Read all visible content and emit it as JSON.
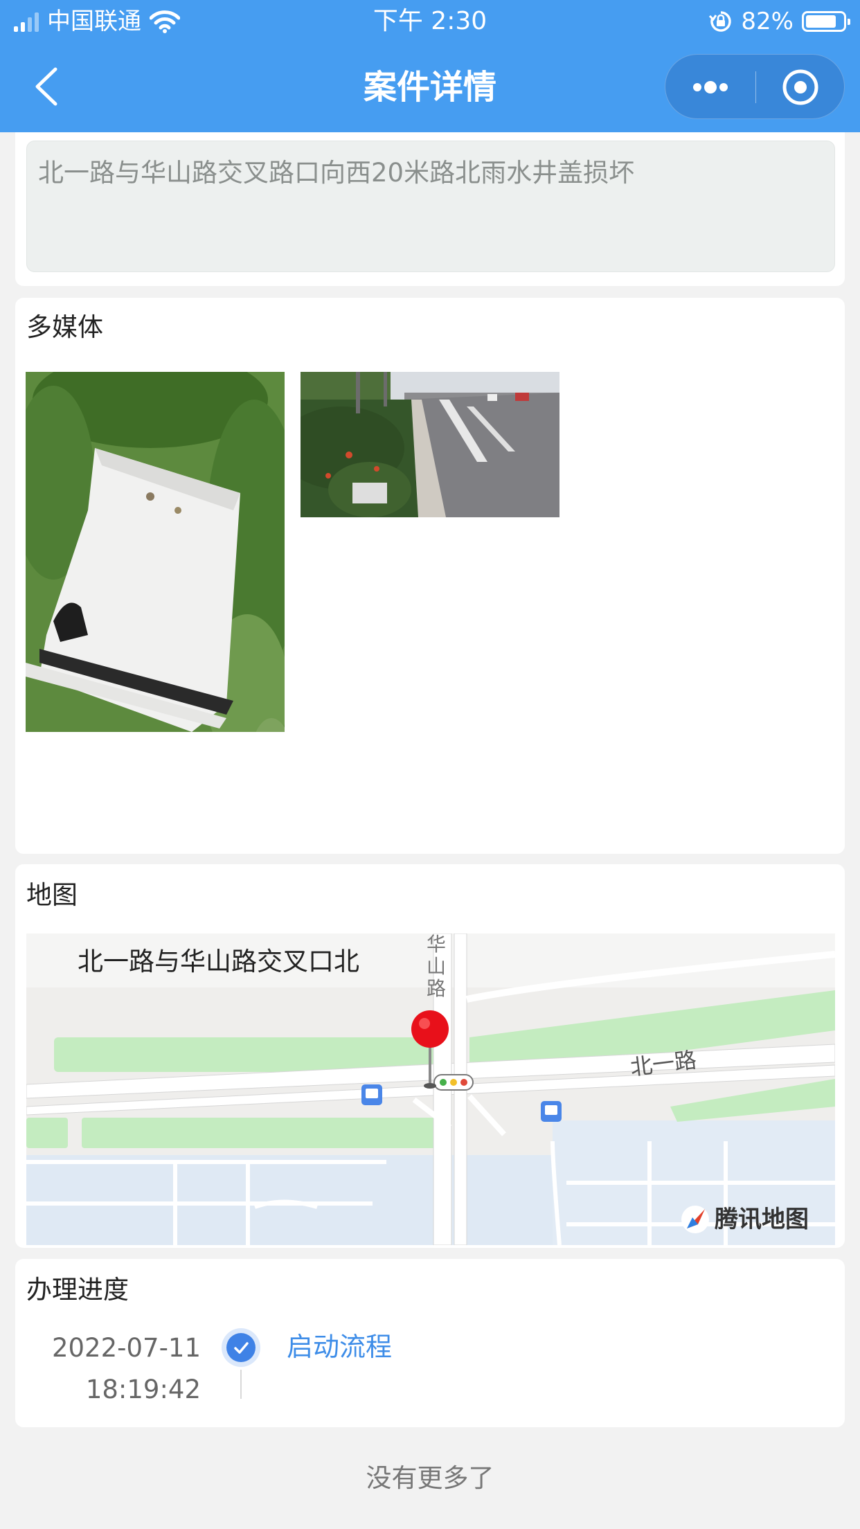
{
  "status_bar": {
    "carrier": "中国联通",
    "time": "下午 2:30",
    "battery_percent_text": "82%",
    "battery_level": 0.82
  },
  "nav": {
    "title": "案件详情",
    "back_icon": "chevron-left-icon",
    "more_icon": "more-dots-icon",
    "close_icon": "target-circle-icon"
  },
  "description": {
    "text": "北一路与华山路交叉路口向西20米路北雨水井盖损坏"
  },
  "media": {
    "heading": "多媒体",
    "images": [
      "manhole-cover-photo",
      "roadside-photo"
    ]
  },
  "map": {
    "heading": "地图",
    "location_label": "北一路与华山路交叉口北",
    "road_vertical": "华山路",
    "road_horizontal": "北一路",
    "provider": "腾讯地图"
  },
  "progress": {
    "heading": "办理进度",
    "steps": [
      {
        "date": "2022-07-11",
        "time": "18:19:42",
        "label": "启动流程"
      }
    ]
  },
  "footer": {
    "text": "没有更多了"
  },
  "colors": {
    "accent": "#469df1",
    "link": "#3e8de8"
  }
}
